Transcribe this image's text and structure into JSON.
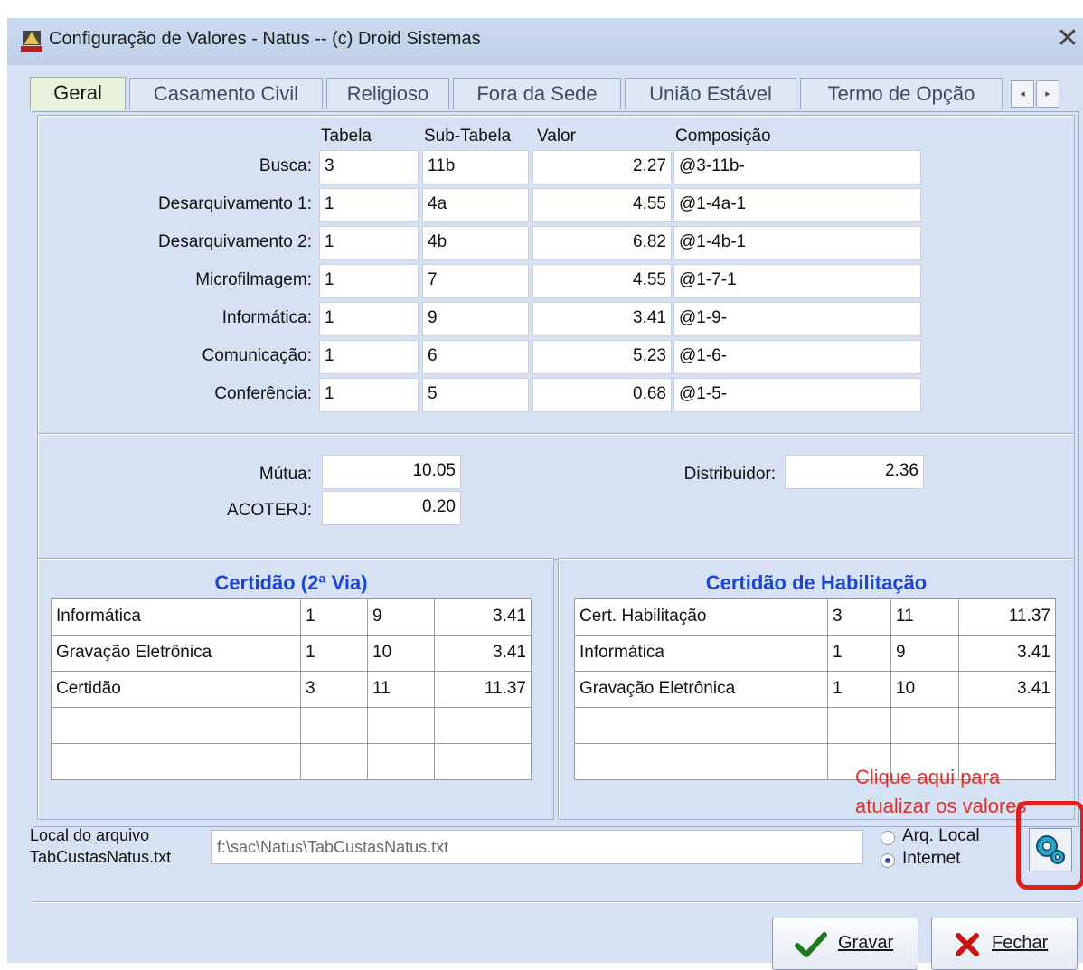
{
  "window": {
    "title": "Configuração de Valores - Natus  --  (c) Droid Sistemas",
    "close_label": "✕"
  },
  "tabs": [
    "Geral",
    "Casamento Civil",
    "Religioso",
    "Fora da Sede",
    "União Estável",
    "Termo de Opção"
  ],
  "tab_scroll": {
    "left": "◂",
    "right": "▸"
  },
  "fees": {
    "headers": {
      "tabela": "Tabela",
      "subtabela": "Sub-Tabela",
      "valor": "Valor",
      "composicao": "Composição"
    },
    "rows": [
      {
        "label": "Busca:",
        "tabela": "3",
        "subtabela": "11b",
        "valor": "2.27",
        "composicao": "@3-11b-"
      },
      {
        "label": "Desarquivamento 1:",
        "tabela": "1",
        "subtabela": "4a",
        "valor": "4.55",
        "composicao": "@1-4a-1"
      },
      {
        "label": "Desarquivamento 2:",
        "tabela": "1",
        "subtabela": "4b",
        "valor": "6.82",
        "composicao": "@1-4b-1"
      },
      {
        "label": "Microfilmagem:",
        "tabela": "1",
        "subtabela": "7",
        "valor": "4.55",
        "composicao": "@1-7-1"
      },
      {
        "label": "Informática:",
        "tabela": "1",
        "subtabela": "9",
        "valor": "3.41",
        "composicao": "@1-9-"
      },
      {
        "label": "Comunicação:",
        "tabela": "1",
        "subtabela": "6",
        "valor": "5.23",
        "composicao": "@1-6-"
      },
      {
        "label": "Conferência:",
        "tabela": "1",
        "subtabela": "5",
        "valor": "0.68",
        "composicao": "@1-5-"
      }
    ]
  },
  "extras": {
    "mutua_label": "Mútua:",
    "mutua_value": "10.05",
    "acoterj_label": "ACOTERJ:",
    "acoterj_value": "0.20",
    "distribuidor_label": "Distribuidor:",
    "distribuidor_value": "2.36"
  },
  "certidao_2via": {
    "title": "Certidão (2ª Via)",
    "rows": [
      [
        "Informática",
        "1",
        "9",
        "3.41"
      ],
      [
        "Gravação Eletrônica",
        "1",
        "10",
        "3.41"
      ],
      [
        "Certidão",
        "3",
        "11",
        "11.37"
      ],
      [
        "",
        "",
        "",
        ""
      ],
      [
        "",
        "",
        "",
        ""
      ]
    ]
  },
  "certidao_habilitacao": {
    "title": "Certidão de Habilitação",
    "rows": [
      [
        "Cert. Habilitação",
        "3",
        "11",
        "11.37"
      ],
      [
        "Informática",
        "1",
        "9",
        "3.41"
      ],
      [
        "Gravação Eletrônica",
        "1",
        "10",
        "3.41"
      ],
      [
        "",
        "",
        "",
        ""
      ],
      [
        "",
        "",
        "",
        ""
      ]
    ]
  },
  "file": {
    "label_line1": "Local do arquivo",
    "label_line2": "TabCustasNatus.txt",
    "path": "f:\\sac\\Natus\\TabCustasNatus.txt",
    "radio_local": "Arq. Local",
    "radio_internet": "Internet",
    "selected": "Internet"
  },
  "callout": {
    "line1": "Clique aqui para",
    "line2": "atualizar os valores",
    "color": "#e0302a"
  },
  "buttons": {
    "gravar": "Gravar",
    "fechar": "Fechar"
  },
  "colors": {
    "window_bg": "#d7e1f4",
    "group_title": "#1d45d4",
    "highlight": "#e01e1e"
  }
}
